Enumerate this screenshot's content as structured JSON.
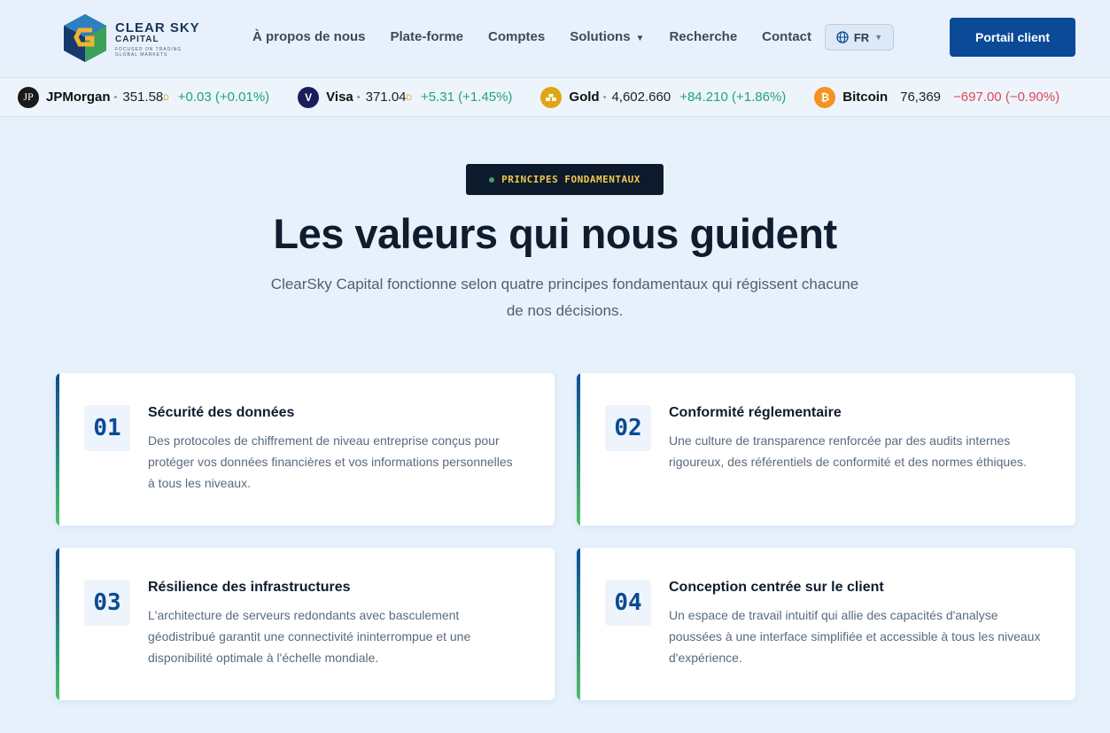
{
  "brand": {
    "name": "CLEAR SKY",
    "sub": "CAPITAL",
    "tagline": "FOCUSED ON TRADING GLOBAL MARKETS"
  },
  "nav": {
    "items": [
      {
        "label": "À propos de nous"
      },
      {
        "label": "Plate-forme"
      },
      {
        "label": "Comptes"
      },
      {
        "label": "Solutions"
      },
      {
        "label": "Recherche"
      },
      {
        "label": "Contact"
      }
    ],
    "lang": "FR",
    "portal_label": "Portail client"
  },
  "ticker": [
    {
      "icon": "jpmorgan-icon",
      "icon_text": "JP",
      "color": "#1a1a1a",
      "name": "JPMorgan",
      "price": "351.58",
      "sup": "D",
      "change": "+0.03 (+0.01%)",
      "direction": "up"
    },
    {
      "icon": "visa-icon",
      "icon_text": "V",
      "color": "#1a1f5c",
      "name": "Visa",
      "price": "371.04",
      "sup": "D",
      "change": "+5.31 (+1.45%)",
      "direction": "up"
    },
    {
      "icon": "gold-icon",
      "icon_text": "",
      "color": "#e0a514",
      "name": "Gold",
      "price": "4,602.660",
      "sup": "",
      "change": "+84.210 (+1.86%)",
      "direction": "up"
    },
    {
      "icon": "bitcoin-icon",
      "icon_text": "₿",
      "color": "#f39322",
      "name": "Bitcoin",
      "price": "76,369",
      "sup": "",
      "change": "−697.00 (−0.90%)",
      "direction": "down"
    }
  ],
  "hero": {
    "badge": "PRINCIPES FONDAMENTAUX",
    "title": "Les valeurs qui nous guident",
    "subtitle": "ClearSky Capital fonctionne selon quatre principes fondamentaux qui régissent chacune de nos décisions."
  },
  "cards": [
    {
      "number": "01",
      "title": "Sécurité des données",
      "text": "Des protocoles de chiffrement de niveau entreprise conçus pour protéger vos données financières et vos informations personnelles à tous les niveaux."
    },
    {
      "number": "02",
      "title": "Conformité réglementaire",
      "text": "Une culture de transparence renforcée par des audits internes rigoureux, des référentiels de conformité et des normes éthiques."
    },
    {
      "number": "03",
      "title": "Résilience des infrastructures",
      "text": "L'architecture de serveurs redondants avec basculement géodistribué garantit une connectivité ininterrompue et une disponibilité optimale à l'échelle mondiale."
    },
    {
      "number": "04",
      "title": "Conception centrée sur le client",
      "text": "Un espace de travail intuitif qui allie des capacités d'analyse poussées à une interface simplifiée et accessible à tous les niveaux d'expérience."
    }
  ]
}
